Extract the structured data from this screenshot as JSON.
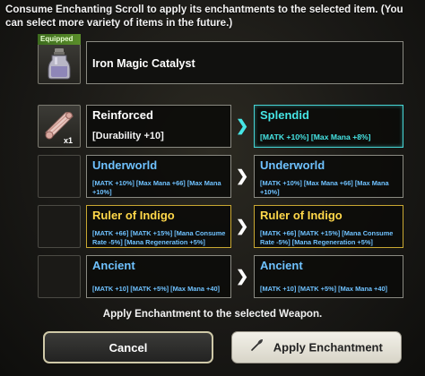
{
  "instructions": "Consume Enchanting Scroll to apply its enchantments to the selected item. (You can select more variety of items in the future.)",
  "equipped": {
    "tag": "Equipped",
    "item_name": "Iron Magic Catalyst",
    "icon": "potion-bottle-icon"
  },
  "scroll": {
    "icon": "scroll-icon",
    "count": "x1"
  },
  "rows": [
    {
      "current": {
        "title": "Reinforced",
        "stats": "[Durability +10]"
      },
      "result": {
        "title": "Splendid",
        "stats": "[MATK +10%] [Max Mana +8%]"
      },
      "arrow_color": "#46e6e6"
    },
    {
      "current": {
        "title": "Underworld",
        "stats": "[MATK +10%] [Max Mana +66] [Max Mana +10%]"
      },
      "result": {
        "title": "Underworld",
        "stats": "[MATK +10%] [Max Mana +66] [Max Mana +10%]"
      },
      "arrow_color": "#ffffff"
    },
    {
      "current": {
        "title": "Ruler of Indigo",
        "stats": "[MATK +66] [MATK +15%] [Mana Consume Rate -5%] [Mana Regeneration +5%]"
      },
      "result": {
        "title": "Ruler of Indigo",
        "stats": "[MATK +66] [MATK +15%] [Mana Consume Rate -5%] [Mana Regeneration +5%]"
      },
      "arrow_color": "#ffffff"
    },
    {
      "current": {
        "title": "Ancient",
        "stats": "[MATK +10] [MATK +5%] [Max Mana +40]"
      },
      "result": {
        "title": "Ancient",
        "stats": "[MATK +10] [MATK +5%] [Max Mana +40]"
      },
      "arrow_color": "#ffffff"
    }
  ],
  "footer_message": "Apply Enchantment to the selected Weapon.",
  "buttons": {
    "cancel": "Cancel",
    "apply": "Apply Enchantment",
    "apply_icon": "quill-icon"
  }
}
